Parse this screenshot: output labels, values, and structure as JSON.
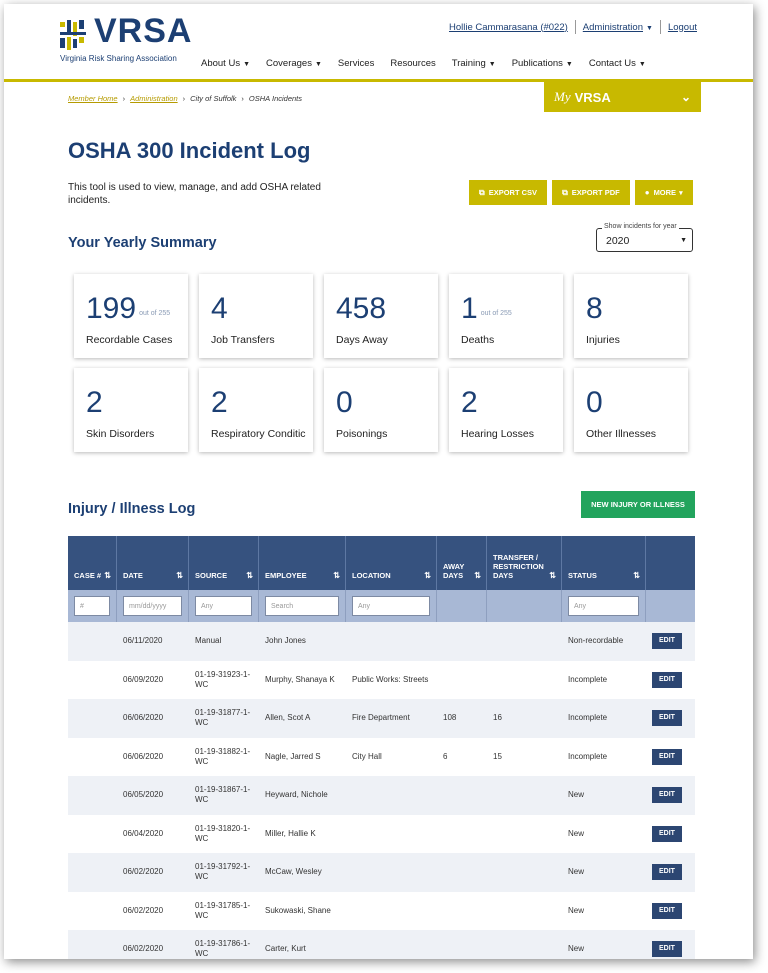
{
  "brand": {
    "name": "VRSA",
    "tagline": "Virginia Risk Sharing Association",
    "colors": {
      "primary": "#1c3f73",
      "accent": "#c8b900",
      "green": "#22a45d"
    }
  },
  "user_links": {
    "user": "Hollie Cammarasana (#022)",
    "admin": "Administration",
    "logout": "Logout"
  },
  "nav": [
    {
      "label": "About Us",
      "dropdown": true
    },
    {
      "label": "Coverages",
      "dropdown": true
    },
    {
      "label": "Services",
      "dropdown": false
    },
    {
      "label": "Resources",
      "dropdown": false
    },
    {
      "label": "Training",
      "dropdown": true
    },
    {
      "label": "Publications",
      "dropdown": true
    },
    {
      "label": "Contact Us",
      "dropdown": true
    }
  ],
  "breadcrumb": [
    "Member Home",
    "Administration",
    "City of Suffolk",
    "OSHA Incidents"
  ],
  "myvrsa": {
    "my": "My",
    "label": "VRSA"
  },
  "page": {
    "title": "OSHA 300 Incident Log",
    "description": "This tool is used to view, manage, and add OSHA related incidents.",
    "buttons": {
      "export_csv": "EXPORT CSV",
      "export_pdf": "EXPORT PDF",
      "more": "MORE"
    }
  },
  "summary": {
    "title": "Your Yearly Summary",
    "year_label": "Show incidents for year",
    "year": "2020",
    "cards": [
      {
        "value": "199",
        "of": "out of 255",
        "label": "Recordable Cases"
      },
      {
        "value": "4",
        "of": "",
        "label": "Job Transfers"
      },
      {
        "value": "458",
        "of": "",
        "label": "Days Away"
      },
      {
        "value": "1",
        "of": "out of 255",
        "label": "Deaths"
      },
      {
        "value": "8",
        "of": "",
        "label": "Injuries"
      },
      {
        "value": "2",
        "of": "",
        "label": "Skin Disorders"
      },
      {
        "value": "2",
        "of": "",
        "label": "Respiratory Conditic"
      },
      {
        "value": "0",
        "of": "",
        "label": "Poisonings"
      },
      {
        "value": "2",
        "of": "",
        "label": "Hearing Losses"
      },
      {
        "value": "0",
        "of": "",
        "label": "Other Illnesses"
      }
    ]
  },
  "log": {
    "title": "Injury / Illness Log",
    "new_button": "NEW INJURY OR ILLNESS",
    "headers": {
      "case": "CASE #",
      "date": "DATE",
      "source": "SOURCE",
      "employee": "EMPLOYEE",
      "location": "LOCATION",
      "away": "AWAY DAYS",
      "transfer": "TRANSFER / RESTRICTION DAYS",
      "status": "STATUS"
    },
    "filters": {
      "case": "#",
      "date": "mm/dd/yyyy",
      "source": "Any",
      "employee": "Search",
      "location": "Any",
      "status": "Any"
    },
    "edit_label": "EDIT",
    "rows": [
      {
        "case": "",
        "date": "06/11/2020",
        "source": "Manual",
        "employee": "John Jones",
        "location": "",
        "away": "",
        "transfer": "",
        "status": "Non-recordable"
      },
      {
        "case": "",
        "date": "06/09/2020",
        "source": "01-19-31923-1-WC",
        "employee": "Murphy, Shanaya K",
        "location": "Public Works: Streets",
        "away": "",
        "transfer": "",
        "status": "Incomplete"
      },
      {
        "case": "",
        "date": "06/06/2020",
        "source": "01-19-31877-1-WC",
        "employee": "Allen, Scot A",
        "location": "Fire Department",
        "away": "108",
        "transfer": "16",
        "status": "Incomplete"
      },
      {
        "case": "",
        "date": "06/06/2020",
        "source": "01-19-31882-1-WC",
        "employee": "Nagle, Jarred S",
        "location": "City Hall",
        "away": "6",
        "transfer": "15",
        "status": "Incomplete"
      },
      {
        "case": "",
        "date": "06/05/2020",
        "source": "01-19-31867-1-WC",
        "employee": "Heyward, Nichole",
        "location": "",
        "away": "",
        "transfer": "",
        "status": "New"
      },
      {
        "case": "",
        "date": "06/04/2020",
        "source": "01-19-31820-1-WC",
        "employee": "Miller, Hallie K",
        "location": "",
        "away": "",
        "transfer": "",
        "status": "New"
      },
      {
        "case": "",
        "date": "06/02/2020",
        "source": "01-19-31792-1-WC",
        "employee": "McCaw, Wesley",
        "location": "",
        "away": "",
        "transfer": "",
        "status": "New"
      },
      {
        "case": "",
        "date": "06/02/2020",
        "source": "01-19-31785-1-WC",
        "employee": "Sukowaski, Shane",
        "location": "",
        "away": "",
        "transfer": "",
        "status": "New"
      },
      {
        "case": "",
        "date": "06/02/2020",
        "source": "01-19-31786-1-WC",
        "employee": "Carter, Kurt",
        "location": "",
        "away": "",
        "transfer": "",
        "status": "New"
      }
    ]
  }
}
